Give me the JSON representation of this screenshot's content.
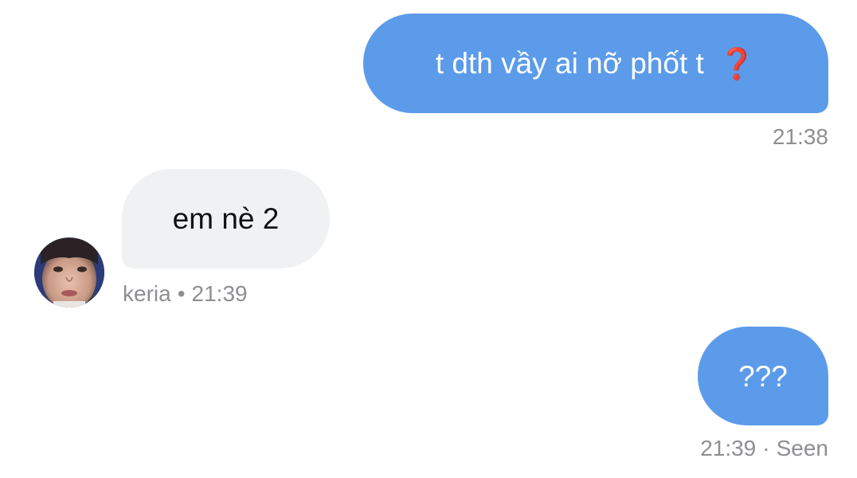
{
  "messages": [
    {
      "direction": "outgoing",
      "text": "t dth vầy ai nỡ phốt t",
      "icon": "red-question-mark-icon",
      "meta_time": "21:38"
    },
    {
      "direction": "incoming",
      "text": "em nè 2",
      "avatar": "user-avatar",
      "meta_sender": "keria",
      "meta_time": "21:39"
    },
    {
      "direction": "outgoing",
      "text": "???",
      "meta_time": "21:39",
      "meta_status": "Seen"
    }
  ],
  "separator": "•",
  "separator_seen": "·",
  "colors": {
    "outgoing_bubble": "#5b9bea",
    "incoming_bubble": "#f0f1f3",
    "meta_text": "#8e8e93",
    "question_icon": "#d42a20"
  }
}
